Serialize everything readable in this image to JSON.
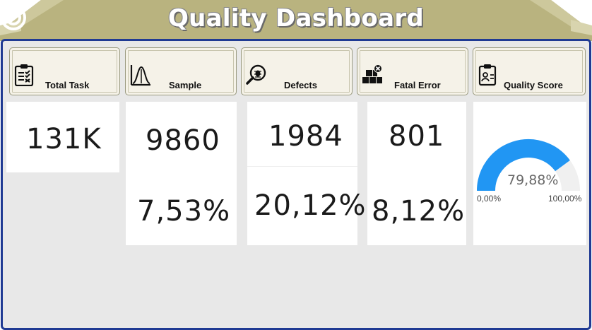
{
  "header": {
    "title": "Quality Dashboard",
    "icon": "target-icon",
    "colors": {
      "banner": "#b8b27e",
      "banner_light": "#d6d2a8",
      "frame_border": "#1f3a93"
    }
  },
  "kpis": [
    {
      "label": "Total Task",
      "icon": "clipboard-checklist-icon",
      "value": "131K"
    },
    {
      "label": "Sample",
      "icon": "bell-curve-icon",
      "value": "9860",
      "percent": "7,53%"
    },
    {
      "label": "Defects",
      "icon": "bug-magnifier-icon",
      "value": "1984",
      "percent": "20,12%"
    },
    {
      "label": "Fatal Error",
      "icon": "stacked-boxes-error-icon",
      "value": "801",
      "percent": "8,12%"
    },
    {
      "label": "Quality Score",
      "icon": "clipboard-person-icon"
    }
  ],
  "gauge": {
    "value": "79,88%",
    "fraction": 0.7988,
    "min_label": "0,00%",
    "max_label": "100,00%",
    "fill_color": "#2196f3",
    "track_color": "#f0f0f0"
  }
}
